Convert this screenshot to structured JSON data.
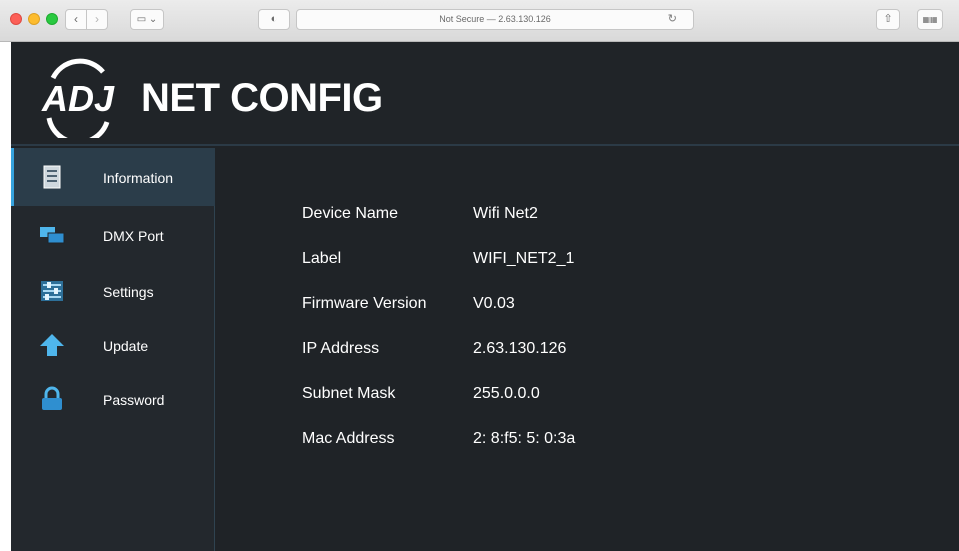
{
  "browser": {
    "url": "Not Secure — 2.63.130.126"
  },
  "app": {
    "logo_text": "ADJ",
    "title": "NET CONFIG"
  },
  "sidebar": {
    "items": [
      {
        "label": "Information",
        "icon": "document-icon",
        "active": true
      },
      {
        "label": "DMX Port",
        "icon": "monitor-icon",
        "active": false
      },
      {
        "label": "Settings",
        "icon": "sliders-icon",
        "active": false
      },
      {
        "label": "Update",
        "icon": "upload-arrow-icon",
        "active": false
      },
      {
        "label": "Password",
        "icon": "lock-icon",
        "active": false
      }
    ]
  },
  "info": {
    "rows": [
      {
        "key": "Device Name",
        "value": "Wifi Net2"
      },
      {
        "key": "Label",
        "value": "WIFI_NET2_1"
      },
      {
        "key": "Firmware Version",
        "value": "V0.03"
      },
      {
        "key": "IP Address",
        "value": "2.63.130.126"
      },
      {
        "key": "Subnet Mask",
        "value": "255.0.0.0"
      },
      {
        "key": "Mac Address",
        "value": "2: 8:f5: 5: 0:3a"
      }
    ]
  },
  "colors": {
    "accent": "#36a3de",
    "background": "#1f2327",
    "active_item": "#2b3d4a"
  }
}
